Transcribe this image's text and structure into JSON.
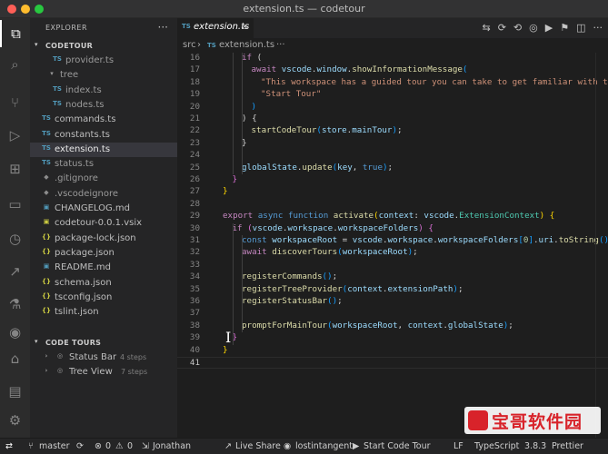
{
  "window": {
    "title": "extension.ts — codetour"
  },
  "activity_bar": [
    {
      "name": "explorer",
      "glyph": "⧉"
    },
    {
      "name": "search",
      "glyph": "⌕"
    },
    {
      "name": "source-control",
      "glyph": "⑂"
    },
    {
      "name": "run-debug",
      "glyph": "▷"
    },
    {
      "name": "extensions",
      "glyph": "⊞"
    },
    {
      "name": "remote-explorer",
      "glyph": "▭"
    },
    {
      "name": "timeline",
      "glyph": "◷"
    },
    {
      "name": "live-share",
      "glyph": "↗"
    },
    {
      "name": "test",
      "glyph": "⚗"
    },
    {
      "name": "github",
      "glyph": "◉"
    },
    {
      "name": "codetour",
      "glyph": "⌂"
    },
    {
      "name": "notes",
      "glyph": "▤"
    },
    {
      "name": "accounts",
      "glyph": "⚙"
    }
  ],
  "sidebar": {
    "title": "EXPLORER",
    "more": "···",
    "workspace": {
      "label": "CODETOUR",
      "chevron": "▾"
    },
    "files": [
      {
        "icon": "TS",
        "icon_color": "#519aba",
        "name": "provider.ts",
        "name_color": "#9a9a9a"
      },
      {
        "icon": "▾",
        "icon_color": "#9a9a9a",
        "name": "tree",
        "name_color": "#9a9a9a"
      },
      {
        "icon": "TS",
        "icon_color": "#519aba",
        "name": "index.ts",
        "name_color": "#9a9a9a"
      },
      {
        "icon": "TS",
        "icon_color": "#519aba",
        "name": "nodes.ts",
        "name_color": "#9a9a9a"
      },
      {
        "icon": "TS",
        "icon_color": "#519aba",
        "name": "commands.ts",
        "name_color": "#bdbdbd"
      },
      {
        "icon": "TS",
        "icon_color": "#519aba",
        "name": "constants.ts",
        "name_color": "#bdbdbd"
      },
      {
        "icon": "TS",
        "icon_color": "#519aba",
        "name": "extension.ts",
        "name_color": "#e8e8e8",
        "selected": true
      },
      {
        "icon": "TS",
        "icon_color": "#519aba",
        "name": "status.ts",
        "name_color": "#9a9a9a"
      },
      {
        "icon": "◆",
        "icon_color": "#8c8c8c",
        "name": ".gitignore",
        "name_color": "#9a9a9a"
      },
      {
        "icon": "◆",
        "icon_color": "#8c8c8c",
        "name": ".vscodeignore",
        "name_color": "#9a9a9a"
      },
      {
        "icon": "▣",
        "icon_color": "#519aba",
        "name": "CHANGELOG.md",
        "name_color": "#bdbdbd"
      },
      {
        "icon": "▣",
        "icon_color": "#cbcb41",
        "name": "codetour-0.0.1.vsix",
        "name_color": "#bdbdbd"
      },
      {
        "icon": "{}",
        "icon_color": "#cbcb41",
        "name": "package-lock.json",
        "name_color": "#bdbdbd"
      },
      {
        "icon": "{}",
        "icon_color": "#cbcb41",
        "name": "package.json",
        "name_color": "#bdbdbd"
      },
      {
        "icon": "▣",
        "icon_color": "#519aba",
        "name": "README.md",
        "name_color": "#bdbdbd"
      },
      {
        "icon": "{}",
        "icon_color": "#cbcb41",
        "name": "schema.json",
        "name_color": "#bdbdbd"
      },
      {
        "icon": "{}",
        "icon_color": "#cbcb41",
        "name": "tsconfig.json",
        "name_color": "#bdbdbd"
      },
      {
        "icon": "{}",
        "icon_color": "#cbcb41",
        "name": "tslint.json",
        "name_color": "#bdbdbd"
      }
    ],
    "code_tours": {
      "label": "CODE TOURS",
      "chevron": "▾",
      "tours": [
        {
          "name": "Status Bar",
          "steps": "4 steps"
        },
        {
          "name": "Tree View",
          "steps": "7 steps"
        }
      ]
    }
  },
  "editor": {
    "tab": {
      "icon": "TS",
      "label": "extension.ts",
      "close": "×"
    },
    "tab_actions": [
      "⇆",
      "⟳",
      "⟲",
      "◎",
      "▶",
      "⚑",
      "◫",
      "···"
    ],
    "breadcrumbs": {
      "folder": "src",
      "sep": "›",
      "icon": "TS",
      "file": "extension.ts",
      "more": "···"
    },
    "current_line": "41",
    "lines": [
      {
        "num": "16",
        "indent": 2,
        "segs": [
          [
            "kw",
            "if"
          ],
          [
            "pn",
            " ("
          ]
        ]
      },
      {
        "num": "17",
        "indent": 3,
        "segs": [
          [
            "kw",
            "await"
          ],
          [
            "pn",
            " "
          ],
          [
            "vr",
            "vscode"
          ],
          [
            "pn",
            "."
          ],
          [
            "vr",
            "window"
          ],
          [
            "pn",
            "."
          ],
          [
            "fn",
            "showInformationMessage"
          ],
          [
            "b3",
            "("
          ]
        ]
      },
      {
        "num": "18",
        "indent": 4,
        "segs": [
          [
            "st",
            "\"This workspace has a guided tour you can take to get familiar with the"
          ]
        ]
      },
      {
        "num": "19",
        "indent": 4,
        "segs": [
          [
            "st",
            "\"Start Tour\""
          ]
        ]
      },
      {
        "num": "20",
        "indent": 3,
        "segs": [
          [
            "b3",
            ")"
          ]
        ]
      },
      {
        "num": "21",
        "indent": 2,
        "segs": [
          [
            "pn",
            ") {"
          ]
        ]
      },
      {
        "num": "22",
        "indent": 3,
        "segs": [
          [
            "fn",
            "startCodeTour"
          ],
          [
            "b3",
            "("
          ],
          [
            "vr",
            "store"
          ],
          [
            "pn",
            "."
          ],
          [
            "vr",
            "mainTour"
          ],
          [
            "b3",
            ")"
          ],
          [
            "pn",
            ";"
          ]
        ]
      },
      {
        "num": "23",
        "indent": 2,
        "segs": [
          [
            "pn",
            "}"
          ]
        ]
      },
      {
        "num": "24",
        "indent": 0,
        "segs": []
      },
      {
        "num": "25",
        "indent": 2,
        "segs": [
          [
            "vr",
            "globalState"
          ],
          [
            "pn",
            "."
          ],
          [
            "fn",
            "update"
          ],
          [
            "b3",
            "("
          ],
          [
            "vr",
            "key"
          ],
          [
            "pn",
            ", "
          ],
          [
            "kw2",
            "true"
          ],
          [
            "b3",
            ")"
          ],
          [
            "pn",
            ";"
          ]
        ]
      },
      {
        "num": "26",
        "indent": 1,
        "segs": [
          [
            "b2",
            "}"
          ]
        ]
      },
      {
        "num": "27",
        "indent": 0,
        "segs": [
          [
            "b1",
            "}"
          ]
        ]
      },
      {
        "num": "28",
        "indent": 0,
        "segs": []
      },
      {
        "num": "29",
        "indent": 0,
        "segs": [
          [
            "kw",
            "export"
          ],
          [
            "pn",
            " "
          ],
          [
            "kw2",
            "async"
          ],
          [
            "pn",
            " "
          ],
          [
            "kw2",
            "function"
          ],
          [
            "pn",
            " "
          ],
          [
            "fn",
            "activate"
          ],
          [
            "b1",
            "("
          ],
          [
            "vr",
            "context"
          ],
          [
            "pn",
            ": "
          ],
          [
            "vr",
            "vscode"
          ],
          [
            "pn",
            "."
          ],
          [
            "ty",
            "ExtensionContext"
          ],
          [
            "b1",
            ")"
          ],
          [
            "pn",
            " "
          ],
          [
            "b1",
            "{"
          ]
        ]
      },
      {
        "num": "30",
        "indent": 1,
        "segs": [
          [
            "kw",
            "if"
          ],
          [
            "pn",
            " "
          ],
          [
            "b2",
            "("
          ],
          [
            "vr",
            "vscode"
          ],
          [
            "pn",
            "."
          ],
          [
            "vr",
            "workspace"
          ],
          [
            "pn",
            "."
          ],
          [
            "vr",
            "workspaceFolders"
          ],
          [
            "b2",
            ")"
          ],
          [
            "pn",
            " "
          ],
          [
            "b2",
            "{"
          ]
        ]
      },
      {
        "num": "31",
        "indent": 2,
        "segs": [
          [
            "kw2",
            "const"
          ],
          [
            "pn",
            " "
          ],
          [
            "vr",
            "workspaceRoot"
          ],
          [
            "pn",
            " = "
          ],
          [
            "vr",
            "vscode"
          ],
          [
            "pn",
            "."
          ],
          [
            "vr",
            "workspace"
          ],
          [
            "pn",
            "."
          ],
          [
            "vr",
            "workspaceFolders"
          ],
          [
            "b3",
            "["
          ],
          [
            "nm",
            "0"
          ],
          [
            "b3",
            "]"
          ],
          [
            "pn",
            "."
          ],
          [
            "vr",
            "uri"
          ],
          [
            "pn",
            "."
          ],
          [
            "fn",
            "toString"
          ],
          [
            "b3",
            "()"
          ],
          [
            "pn",
            ";"
          ]
        ]
      },
      {
        "num": "32",
        "indent": 2,
        "segs": [
          [
            "kw",
            "await"
          ],
          [
            "pn",
            " "
          ],
          [
            "fn",
            "discoverTours"
          ],
          [
            "b3",
            "("
          ],
          [
            "vr",
            "workspaceRoot"
          ],
          [
            "b3",
            ")"
          ],
          [
            "pn",
            ";"
          ]
        ]
      },
      {
        "num": "33",
        "indent": 0,
        "segs": []
      },
      {
        "num": "34",
        "indent": 2,
        "segs": [
          [
            "fn",
            "registerCommands"
          ],
          [
            "b3",
            "()"
          ],
          [
            "pn",
            ";"
          ]
        ]
      },
      {
        "num": "35",
        "indent": 2,
        "segs": [
          [
            "fn",
            "registerTreeProvider"
          ],
          [
            "b3",
            "("
          ],
          [
            "vr",
            "context"
          ],
          [
            "pn",
            "."
          ],
          [
            "vr",
            "extensionPath"
          ],
          [
            "b3",
            ")"
          ],
          [
            "pn",
            ";"
          ]
        ]
      },
      {
        "num": "36",
        "indent": 2,
        "segs": [
          [
            "fn",
            "registerStatusBar"
          ],
          [
            "b3",
            "()"
          ],
          [
            "pn",
            ";"
          ]
        ]
      },
      {
        "num": "37",
        "indent": 0,
        "segs": []
      },
      {
        "num": "38",
        "indent": 2,
        "segs": [
          [
            "fn",
            "promptForMainTour"
          ],
          [
            "b3",
            "("
          ],
          [
            "vr",
            "workspaceRoot"
          ],
          [
            "pn",
            ", "
          ],
          [
            "vr",
            "context"
          ],
          [
            "pn",
            "."
          ],
          [
            "vr",
            "globalState"
          ],
          [
            "b3",
            ")"
          ],
          [
            "pn",
            ";"
          ]
        ]
      },
      {
        "num": "39",
        "indent": 1,
        "segs": [
          [
            "b2",
            "}"
          ]
        ]
      },
      {
        "num": "40",
        "indent": 0,
        "segs": [
          [
            "b1",
            "}"
          ]
        ]
      },
      {
        "num": "41",
        "indent": 0,
        "segs": []
      }
    ]
  },
  "status_bar": {
    "remote": "⇄",
    "branch_icon": "⑂",
    "branch": "master",
    "sync": "⟳",
    "errors_icon": "⊗",
    "errors": "0",
    "warnings_icon": "⚠",
    "warnings": "0",
    "cursor_icon": "⇲",
    "author": "Jonathan",
    "live_share_icon": "↗",
    "live_share": "Live Share",
    "github_icon": "◉",
    "account": "lostintangent",
    "tour_icon": "▶",
    "start_tour": "Start Code Tour",
    "eol": "LF",
    "language": "TypeScript",
    "ts_version": "3.8.3",
    "formatter": "Prettier"
  },
  "watermark": {
    "text": "宝哥软件园"
  },
  "colors": {
    "accent": "#007acc",
    "selection": "#37373d",
    "ts_icon": "#519aba"
  }
}
